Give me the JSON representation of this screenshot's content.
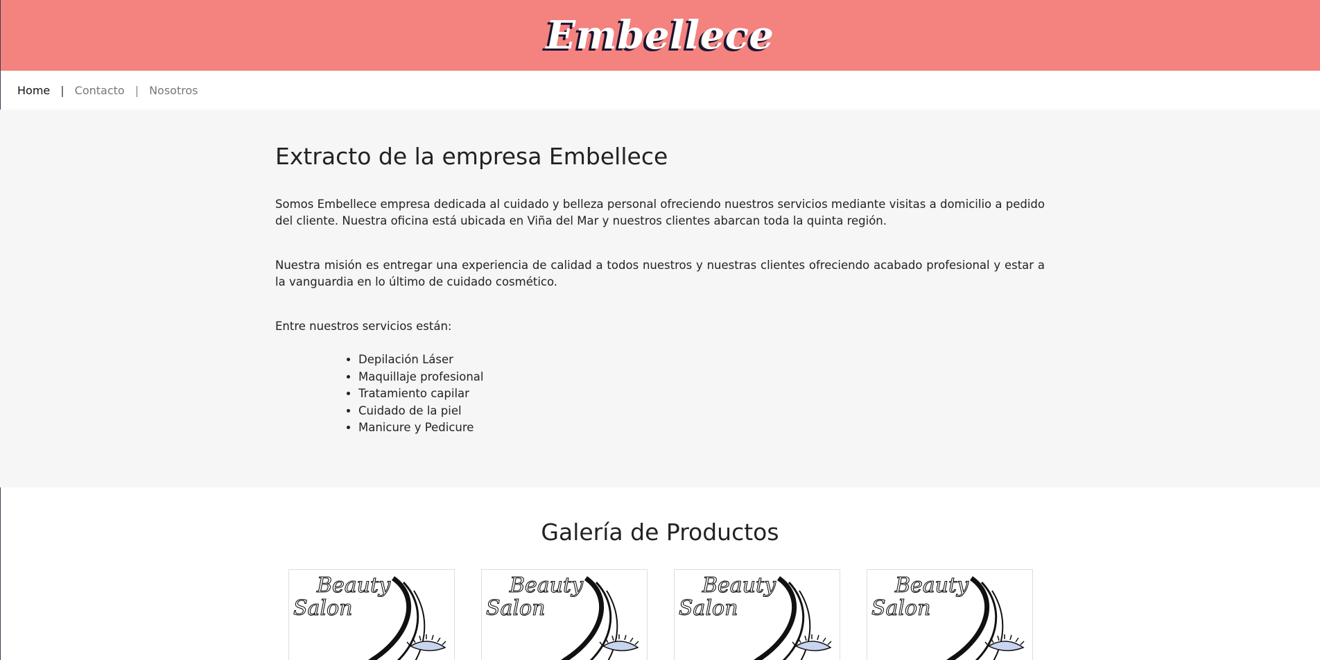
{
  "header": {
    "brand": "Embellece"
  },
  "nav": {
    "home": "Home",
    "sep": "|",
    "contacto": "Contacto",
    "nosotros": "Nosotros"
  },
  "about": {
    "title": "Extracto de la empresa Embellece",
    "p1": "Somos Embellece empresa dedicada al cuidado y belleza personal ofreciendo nuestros servicios mediante visitas a domicilio a pedido del cliente. Nuestra oficina está ubicada en Viña del Mar y nuestros clientes abarcan toda la quinta región.",
    "p2": "Nuestra misión es entregar una experiencia de calidad a todos nuestros y nuestras clientes ofreciendo acabado profesional y estar a la vanguardia en lo último de cuidado cosmético.",
    "p3": "Entre nuestros servicios están:",
    "services": [
      "Depilación Láser",
      "Maquillaje profesional",
      "Tratamiento capilar",
      "Cuidado de la piel",
      "Manicure y Pedicure"
    ]
  },
  "gallery": {
    "title": "Galería de Productos",
    "image_text_line1": "Beauty",
    "image_text_line2": "Salon",
    "colors": {
      "header_bg": "#f4827f",
      "section_bg": "#f6f6f6"
    }
  }
}
